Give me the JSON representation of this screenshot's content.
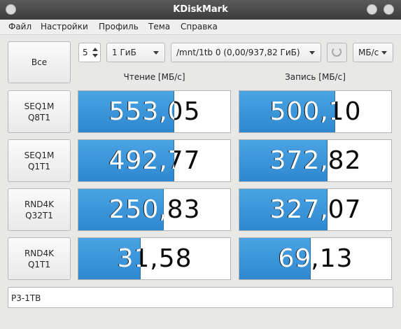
{
  "window": {
    "title": "KDiskMark"
  },
  "menu": [
    "Файл",
    "Настройки",
    "Профиль",
    "Тема",
    "Справка"
  ],
  "toolbar": {
    "all_button": "Все",
    "runs": "5",
    "size": "1 ГиБ",
    "target": "/mnt/1tb 0 (0,00/937,82 ГиБ)",
    "units": "МБ/с"
  },
  "columns": {
    "read": "Чтение [МБ/с]",
    "write": "Запись [МБ/с]"
  },
  "tests": [
    {
      "line1": "SEQ1M",
      "line2": "Q8T1",
      "read": "553,05",
      "write": "500,10",
      "read_fill": 0.63,
      "write_fill": 0.63
    },
    {
      "line1": "SEQ1M",
      "line2": "Q1T1",
      "read": "492,77",
      "write": "372,82",
      "read_fill": 0.63,
      "write_fill": 0.58
    },
    {
      "line1": "RND4K",
      "line2": "Q32T1",
      "read": "250,83",
      "write": "327,07",
      "read_fill": 0.56,
      "write_fill": 0.58
    },
    {
      "line1": "RND4K",
      "line2": "Q1T1",
      "read": "31,58",
      "write": "69,13",
      "read_fill": 0.41,
      "write_fill": 0.47
    }
  ],
  "comment": "P3-1TB"
}
